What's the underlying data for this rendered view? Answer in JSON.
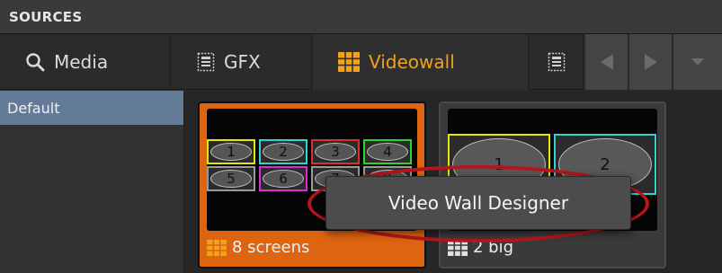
{
  "header": {
    "title": "SOURCES"
  },
  "tabs": [
    {
      "label": "Media",
      "icon": "search-icon"
    },
    {
      "label": "GFX",
      "icon": "gfx-icon"
    },
    {
      "label": "Videowall",
      "icon": "grid-icon",
      "active": true,
      "active_color": "#f2a21a"
    },
    {
      "label": "",
      "icon": "gfx-icon"
    }
  ],
  "sidebar": {
    "items": [
      {
        "label": "Default",
        "selected": true
      }
    ]
  },
  "thumbnails": [
    {
      "label": "8 screens",
      "selected": true,
      "screens": [
        {
          "n": "1",
          "color": "#e6e600"
        },
        {
          "n": "2",
          "color": "#2ed4d4"
        },
        {
          "n": "3",
          "color": "#d43232"
        },
        {
          "n": "4",
          "color": "#2ed42e"
        },
        {
          "n": "5",
          "color": "#9a9a9a"
        },
        {
          "n": "6",
          "color": "#d42ed4"
        },
        {
          "n": "7",
          "color": "#9a9a9a"
        },
        {
          "n": "8",
          "color": "#9a9a9a"
        }
      ]
    },
    {
      "label": "2 big",
      "selected": false,
      "screens": [
        {
          "n": "1",
          "color": "#e6e600"
        },
        {
          "n": "2",
          "color": "#2ed4d4"
        }
      ]
    }
  ],
  "context_menu": {
    "items": [
      "Video Wall Designer"
    ]
  },
  "colors": {
    "accent": "#f2a21a",
    "thumbnail_selected": "#dd6410",
    "sidebar_selected": "#647b98",
    "highlight_ring": "#b6151b"
  }
}
